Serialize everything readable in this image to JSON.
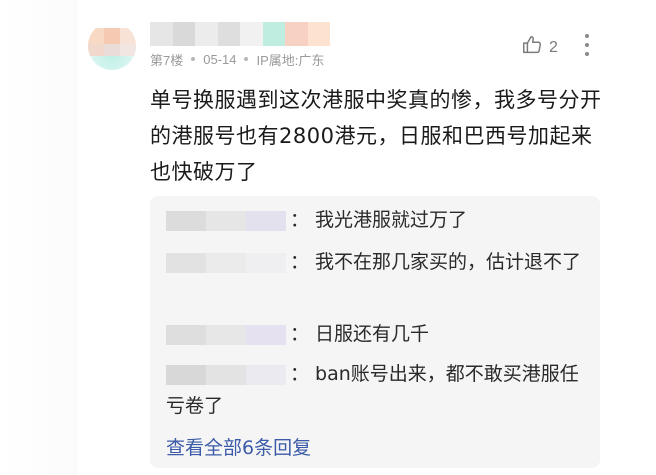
{
  "comment": {
    "floor": "第7楼",
    "date": "05-14",
    "ip_location": "IP属地:广东",
    "like_count": "2",
    "text": "单号换服遇到这次港服中奖真的惨，我多号分开的港服号也有2800港元，日服和巴西号加起来也快破万了"
  },
  "replies": [
    {
      "separator": "：",
      "text": "我光港服就过万了"
    },
    {
      "separator": "：",
      "text": "我不在那几家买的，估计退不了"
    },
    {
      "separator": "：",
      "text": "日服还有几千"
    },
    {
      "separator": "：",
      "text": "ban账号出来，都不敢买港服任亏卷了"
    }
  ],
  "view_all_label": "查看全部6条回复",
  "icons": {
    "like": "thumbs-up-icon",
    "more": "more-vertical-icon"
  },
  "colors": {
    "link": "#3b5aa8",
    "meta": "#9a9a9a",
    "reply_bg": "#f5f5f5"
  }
}
